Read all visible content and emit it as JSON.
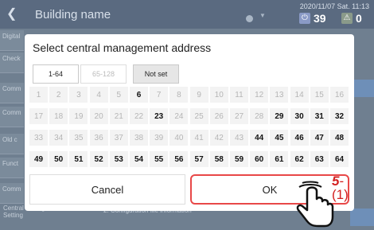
{
  "app": {
    "title": "Building name",
    "datetime": "2020/11/07 Sat. 11:13",
    "power_count": "39",
    "warn_count": "0",
    "power_icon": "power-icon",
    "warn_icon": "warning-icon",
    "sidebar": [
      "Digital",
      "Check",
      "Comm",
      "Comm",
      "Old c",
      "Funct",
      "Comm"
    ],
    "bottom_label": "Central management address Setting",
    "bottom_tab": "2. Configuration file information"
  },
  "dialog": {
    "title": "Select central management address",
    "range_tabs": [
      {
        "label": "1-64",
        "state": "selected"
      },
      {
        "label": "65-128",
        "state": "disabled"
      },
      {
        "label": "Not set",
        "state": "normal"
      }
    ],
    "addresses": [
      [
        1,
        2,
        3,
        4,
        5,
        6,
        7,
        8,
        9,
        10,
        11,
        12,
        13,
        14,
        15,
        16
      ],
      [
        17,
        18,
        19,
        20,
        21,
        22,
        23,
        24,
        25,
        26,
        27,
        28,
        29,
        30,
        31,
        32
      ],
      [
        33,
        34,
        35,
        36,
        37,
        38,
        39,
        40,
        41,
        42,
        43,
        44,
        45,
        46,
        47,
        48
      ],
      [
        49,
        50,
        51,
        52,
        53,
        54,
        55,
        56,
        57,
        58,
        59,
        60,
        61,
        62,
        63,
        64
      ]
    ],
    "enabled_addresses": [
      6,
      23,
      29,
      30,
      31,
      32,
      44,
      45,
      46,
      47,
      48,
      49,
      50,
      51,
      52,
      53,
      54,
      55,
      56,
      57,
      58,
      59,
      60,
      61,
      62,
      63,
      64
    ],
    "cancel_label": "Cancel",
    "ok_label": "OK"
  },
  "annotation": {
    "step": "5",
    "substep": "-(1)",
    "color": "#d32020"
  },
  "colors": {
    "accent": "#e84848",
    "header_bg": "#5a6a80"
  }
}
